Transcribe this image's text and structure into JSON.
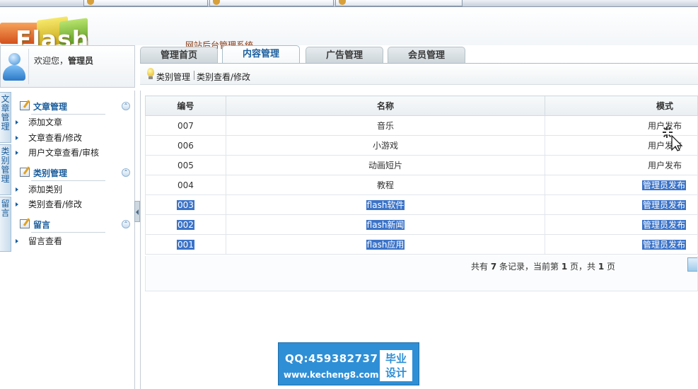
{
  "header": {
    "logo_text": "Flash",
    "system_title": "网站后台管理系统"
  },
  "user": {
    "welcome_prefix": "欢迎您，",
    "username": "管理员"
  },
  "tabs": [
    {
      "label": "管理首页",
      "active": false
    },
    {
      "label": "内容管理",
      "active": true
    },
    {
      "label": "广告管理",
      "active": false
    },
    {
      "label": "会员管理",
      "active": false
    }
  ],
  "subnav": {
    "items": [
      "类别管理",
      "类别查看/修改"
    ]
  },
  "vertical_tabs": [
    "文章管理",
    "类别管理",
    "留言"
  ],
  "menu": {
    "groups": [
      {
        "title": "文章管理",
        "items": [
          "添加文章",
          "文章查看/修改",
          "用户文章查看/审核"
        ]
      },
      {
        "title": "类别管理",
        "items": [
          "添加类别",
          "类别查看/修改"
        ]
      },
      {
        "title": "留言",
        "items": [
          "留言查看"
        ]
      }
    ]
  },
  "table": {
    "headers": [
      "编号",
      "名称",
      "模式"
    ],
    "rows": [
      {
        "id": "007",
        "name": "音乐",
        "mode": "用户发布",
        "selected": false
      },
      {
        "id": "006",
        "name": "小游戏",
        "mode": "用户发布",
        "selected": false
      },
      {
        "id": "005",
        "name": "动画短片",
        "mode": "用户发布",
        "selected": false
      },
      {
        "id": "004",
        "name": "教程",
        "mode": "管理员发布",
        "selected": false,
        "mode_selected": true
      },
      {
        "id": "003",
        "name": "flash软件",
        "mode": "管理员发布",
        "selected": true
      },
      {
        "id": "002",
        "name": "flash新闻",
        "mode": "管理员发布",
        "selected": true
      },
      {
        "id": "001",
        "name": "flash应用",
        "mode": "管理员发布",
        "selected": true
      }
    ]
  },
  "pager": {
    "t1": "共有 ",
    "total": "7",
    "t2": " 条记录，当前第 ",
    "current": "1",
    "t3": " 页，共 ",
    "pages": "1",
    "t4": " 页"
  },
  "watermark": {
    "qq": "QQ:459382737",
    "url": "www.kecheng8.com",
    "badge_line1": "毕业",
    "badge_line2": "设计"
  },
  "colors": {
    "accent": "#1a5e9e",
    "selection": "#3b73c8",
    "title": "#8a3a12"
  }
}
